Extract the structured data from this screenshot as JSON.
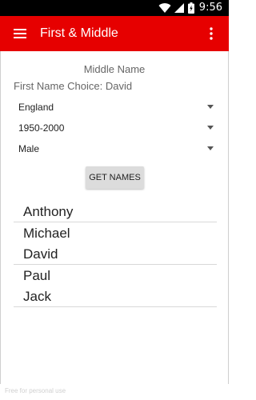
{
  "status_bar": {
    "time": "9:56"
  },
  "app_bar": {
    "title": "First & Middle",
    "menu_icon": "hamburger-menu-icon",
    "overflow_icon": "more-vert-icon",
    "color": "#e60000"
  },
  "main": {
    "subtitle": "Middle Name",
    "choice_label": "First Name Choice: David",
    "spinners": [
      {
        "value": "England"
      },
      {
        "value": "1950-2000"
      },
      {
        "value": "Male"
      }
    ],
    "get_names_label": "GET NAMES",
    "names": [
      "Anthony",
      "Michael",
      "David",
      "Paul",
      "Jack"
    ]
  },
  "watermark": "Free for personal use"
}
